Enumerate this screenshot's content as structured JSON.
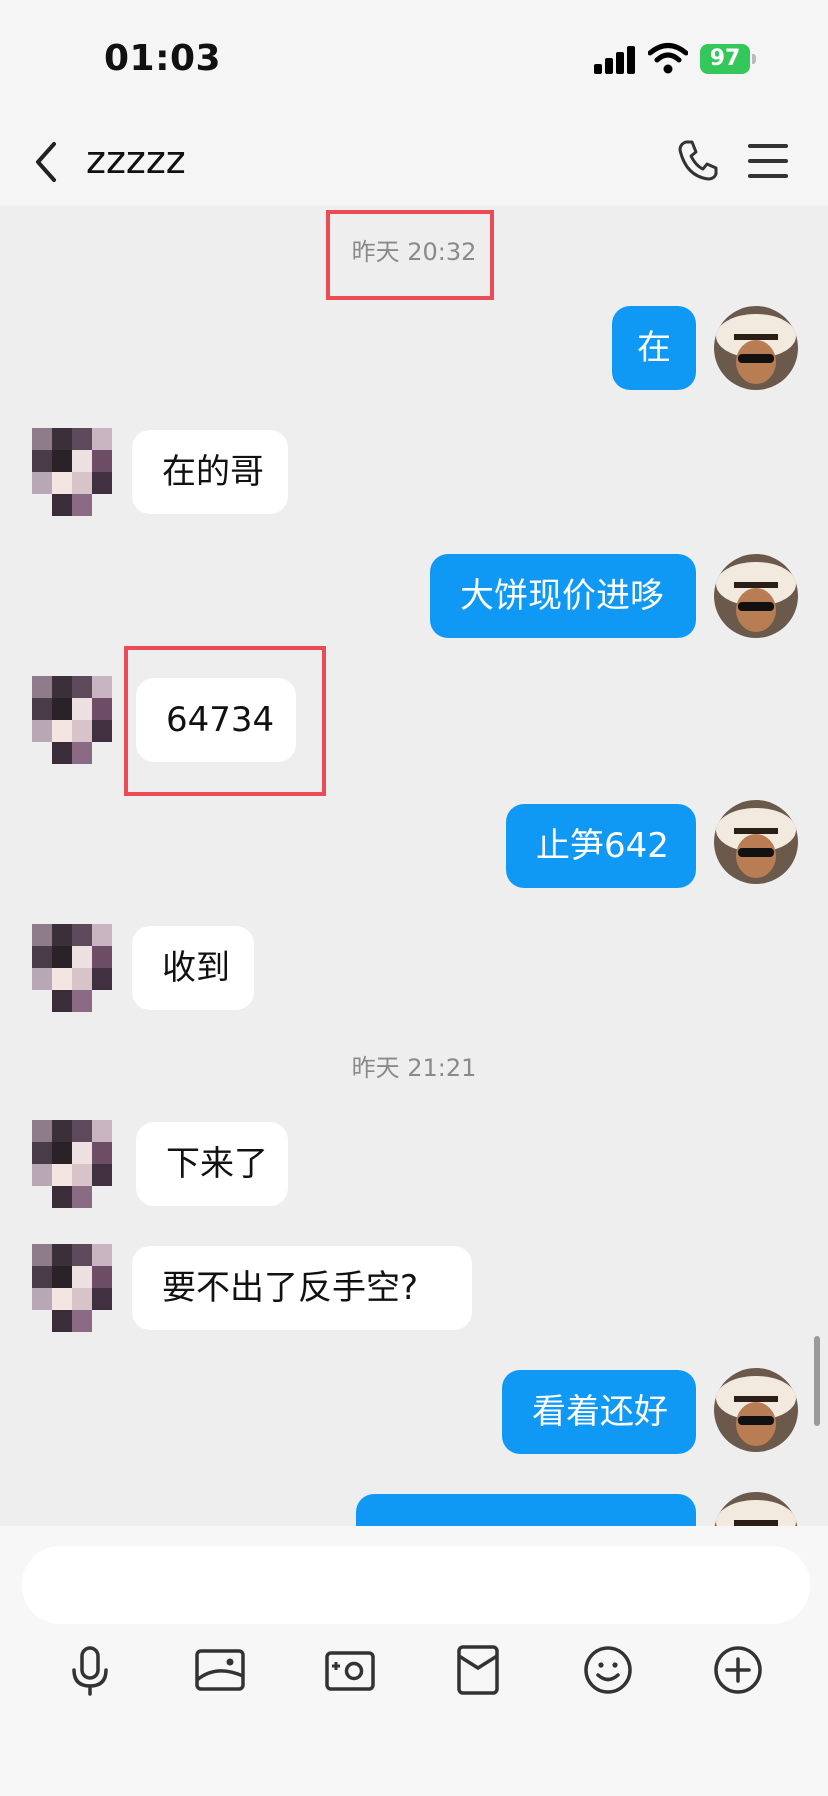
{
  "status": {
    "time": "01:03",
    "battery": "97"
  },
  "nav": {
    "title": "zzzzz"
  },
  "messages": [
    {
      "kind": "timestamp",
      "text": "昨天 20:32"
    },
    {
      "kind": "out",
      "text": "在"
    },
    {
      "kind": "in",
      "text": "在的哥"
    },
    {
      "kind": "out",
      "text": "大饼现价进哆"
    },
    {
      "kind": "in",
      "text": "64734"
    },
    {
      "kind": "out",
      "text": "止笋642"
    },
    {
      "kind": "in",
      "text": "收到"
    },
    {
      "kind": "timestamp",
      "text": "昨天 21:21"
    },
    {
      "kind": "in",
      "text": "下来了"
    },
    {
      "kind": "in",
      "text": "要不出了反手空?"
    },
    {
      "kind": "out",
      "text": "看着还好"
    }
  ],
  "composer": {
    "input_placeholder": "",
    "tools": [
      "microphone-icon",
      "image-icon",
      "camera-icon",
      "red-packet-icon",
      "emoji-icon",
      "plus-icon"
    ]
  },
  "colors": {
    "outgoing_bubble": "#0f99f5",
    "highlight_box": "#ea4b55",
    "battery": "#34c759"
  }
}
